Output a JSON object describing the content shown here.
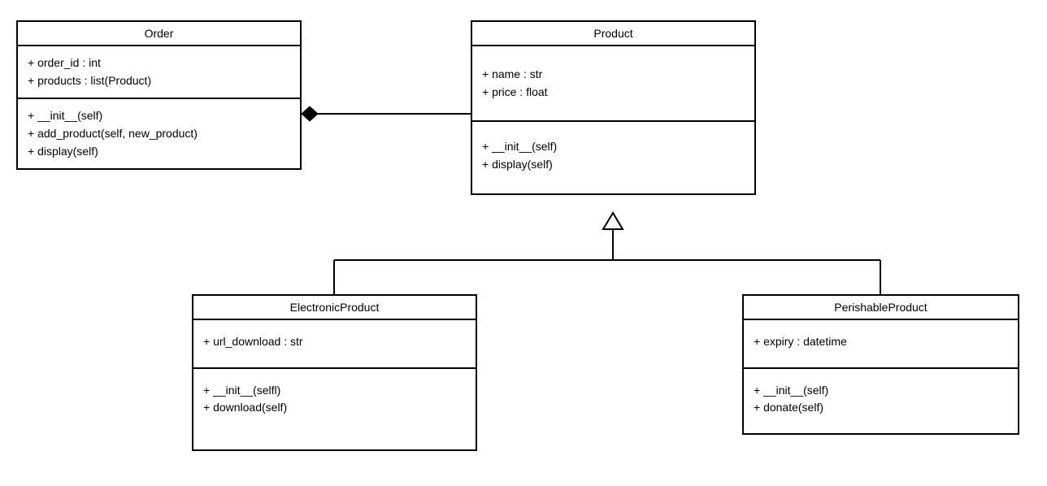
{
  "classes": {
    "order": {
      "name": "Order",
      "attrs": [
        "+ order_id : int",
        "+ products : list(Product)"
      ],
      "methods": [
        "+ __init__(self)",
        "+ add_product(self, new_product)",
        "+ display(self)"
      ]
    },
    "product": {
      "name": "Product",
      "attrs": [
        "+ name : str",
        "+ price : float"
      ],
      "methods": [
        "+ __init__(self)",
        "+ display(self)"
      ]
    },
    "electronic": {
      "name": "ElectronicProduct",
      "attrs": [
        "+ url_download : str"
      ],
      "methods": [
        "+ __init__(selfl)",
        "+ download(self)"
      ]
    },
    "perishable": {
      "name": "PerishableProduct",
      "attrs": [
        "+ expiry : datetime"
      ],
      "methods": [
        "+ __init__(self)",
        "+ donate(self)"
      ]
    }
  }
}
